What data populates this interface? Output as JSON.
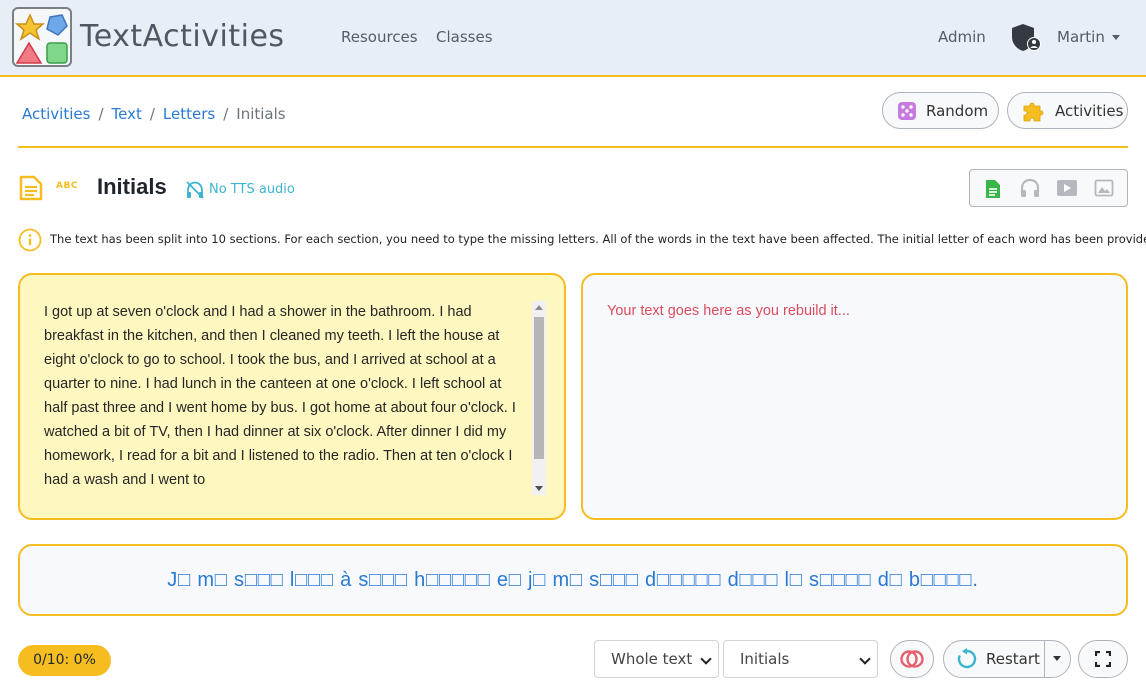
{
  "app": {
    "brand": "TextActivities"
  },
  "nav": {
    "links": [
      {
        "label": "Resources"
      },
      {
        "label": "Classes"
      }
    ],
    "admin": "Admin",
    "user": "Martin"
  },
  "breadcrumb": {
    "items": [
      {
        "label": "Activities"
      },
      {
        "label": "Text"
      },
      {
        "label": "Letters"
      }
    ],
    "current": "Initials"
  },
  "actions": {
    "random": "Random",
    "activities": "Activities"
  },
  "activity": {
    "badge": "ABC",
    "title": "Initials",
    "tts_status": "No TTS audio"
  },
  "info": {
    "text": "The text has been split into 10 sections. For each section, you need to type the missing letters. All of the words in the text have been affected. The initial letter of each word has been provided."
  },
  "source_text": "I got up at seven o'clock and I had a shower in the bathroom. I had breakfast in the kitchen, and then I cleaned my teeth. I left the house at eight o'clock to go to school. I took the bus, and I arrived at school at a quarter to nine. I had lunch in the canteen at one o'clock. I left school at half past three and I went home by bus. I got home at about four o'clock. I watched a bit of TV, then I had dinner at six o'clock. After dinner I did my homework, I read for a bit and I listened to the radio. Then at ten o'clock I had a wash and I went to",
  "rebuild": {
    "placeholder": "Your text goes here as you rebuild it..."
  },
  "masked_section": "J□ m□ s□□□ l□□□ à s□□□ h□□□□□ e□ j□ m□ s□□□ d□□□□□ d□□□ l□ s□□□□ d□ b□□□□.",
  "controls": {
    "score": "0/10: 0%",
    "scope_select": "Whole text",
    "mode_select": "Initials",
    "restart": "Restart"
  },
  "colors": {
    "accent": "#f5bd1f",
    "link": "#2a7ad3",
    "placeholder": "#dc4c5c",
    "tts": "#3bb5cf",
    "doc_green": "#3ab54a"
  }
}
